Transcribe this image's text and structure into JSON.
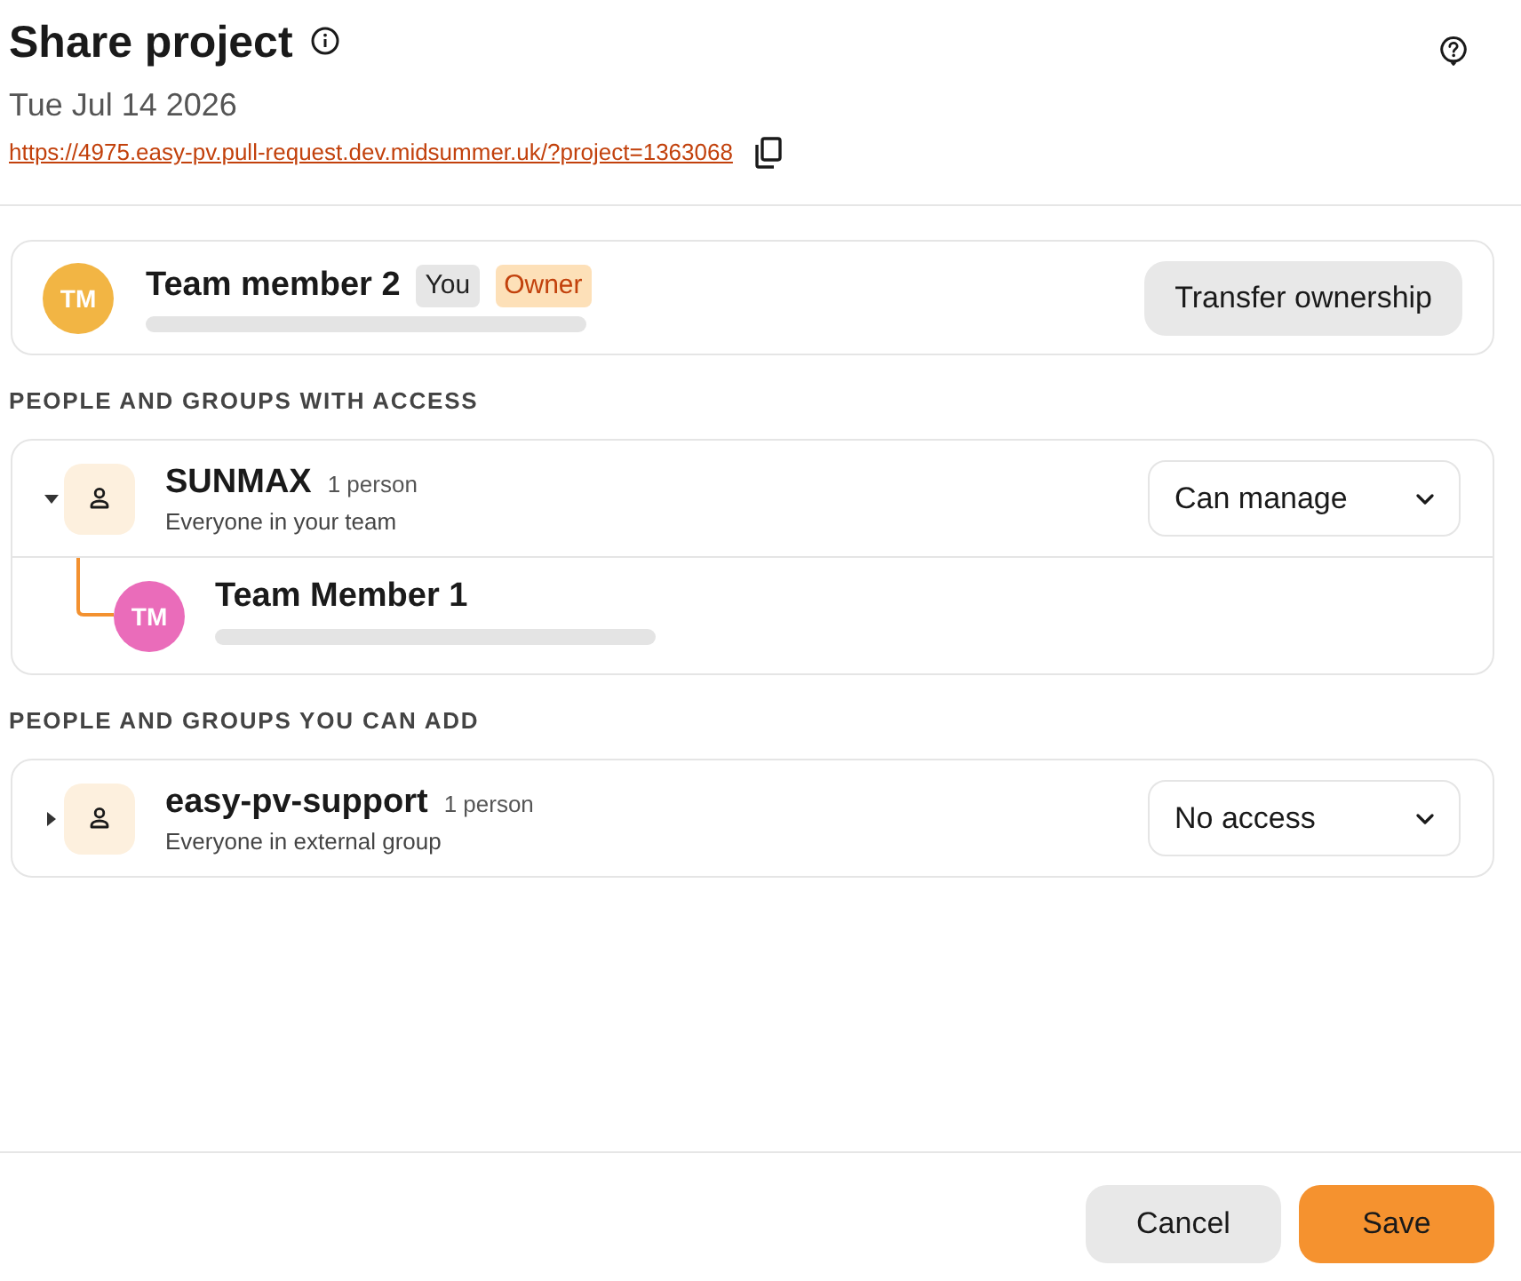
{
  "header": {
    "title": "Share project",
    "date": "Tue Jul 14 2026",
    "link": "https://4975.easy-pv.pull-request.dev.midsummer.uk/?project=1363068"
  },
  "owner": {
    "initials": "TM",
    "color": "#f2b544",
    "name": "Team member 2",
    "badges": [
      {
        "label": "You",
        "kind": "you"
      },
      {
        "label": "Owner",
        "kind": "owner"
      }
    ],
    "button": "Transfer ownership"
  },
  "sections": [
    {
      "heading": "PEOPLE AND GROUPS WITH ACCESS",
      "groups": [
        {
          "name": "SUNMAX",
          "count": "1 person",
          "description": "Everyone in your team",
          "expanded": true,
          "permission": "Can manage",
          "children": [
            {
              "initials": "TM",
              "color": "#ea6cba",
              "name": "Team Member 1"
            }
          ]
        }
      ]
    },
    {
      "heading": "PEOPLE AND GROUPS YOU CAN ADD",
      "groups": [
        {
          "name": "easy-pv-support",
          "count": "1 person",
          "description": "Everyone in external group",
          "expanded": false,
          "permission": "No access"
        }
      ]
    }
  ],
  "footer": {
    "buttons": [
      {
        "label": "Cancel",
        "kind": "secondary"
      },
      {
        "label": "Save",
        "kind": "primary"
      }
    ]
  }
}
